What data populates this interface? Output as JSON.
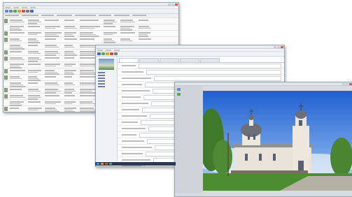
{
  "window_main": {
    "title": "",
    "rows": [
      {
        "thumb": true
      },
      {
        "thumb": false
      },
      {
        "thumb": true
      },
      {
        "thumb": true
      },
      {
        "thumb": false
      },
      {
        "thumb": true
      },
      {
        "thumb": true
      },
      {
        "thumb": false
      },
      {
        "thumb": true
      },
      {
        "thumb": true
      },
      {
        "thumb": false
      },
      {
        "thumb": true
      },
      {
        "thumb": true
      },
      {
        "thumb": false
      },
      {
        "thumb": true
      }
    ]
  },
  "window_form": {
    "title": "",
    "tabs": [
      {
        "label": ""
      },
      {
        "label": ""
      },
      {
        "label": ""
      },
      {
        "label": ""
      },
      {
        "label": ""
      }
    ],
    "fields": [
      {
        "label": ""
      },
      {
        "label": ""
      },
      {
        "label": ""
      },
      {
        "label": ""
      },
      {
        "label": ""
      },
      {
        "label": ""
      },
      {
        "label": ""
      },
      {
        "label": ""
      },
      {
        "label": ""
      },
      {
        "label": ""
      },
      {
        "label": ""
      },
      {
        "label": ""
      },
      {
        "label": ""
      },
      {
        "label": ""
      },
      {
        "label": ""
      },
      {
        "label": ""
      },
      {
        "label": ""
      }
    ]
  },
  "window_photo": {
    "title": "",
    "image_subject": "church-photo"
  },
  "colors": {
    "taskbar": "#2b3a52",
    "sky": "#2f6fd6",
    "grass": "#4d8d32",
    "church_wall": "#e9e3da",
    "dome": "#6c6f78"
  }
}
